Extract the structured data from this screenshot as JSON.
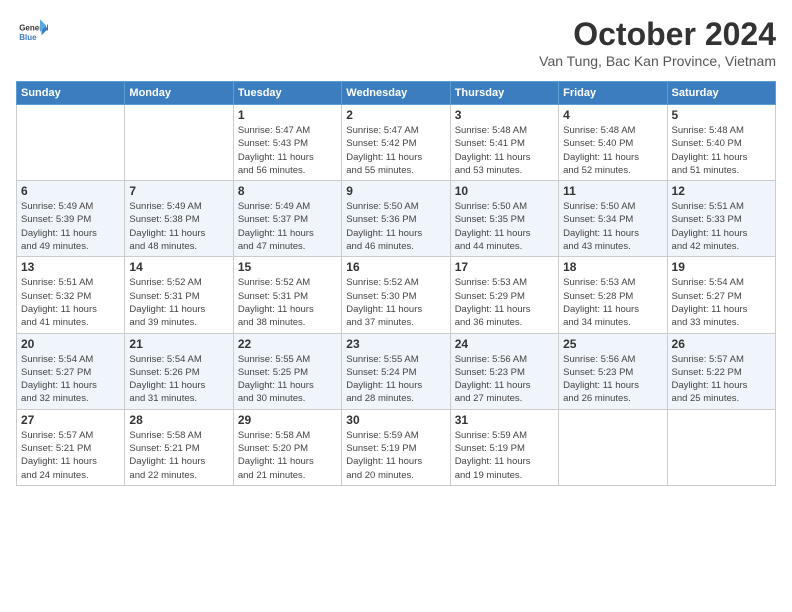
{
  "header": {
    "logo_line1": "General",
    "logo_line2": "Blue",
    "title": "October 2024",
    "subtitle": "Van Tung, Bac Kan Province, Vietnam"
  },
  "weekdays": [
    "Sunday",
    "Monday",
    "Tuesday",
    "Wednesday",
    "Thursday",
    "Friday",
    "Saturday"
  ],
  "weeks": [
    [
      {
        "day": "",
        "info": ""
      },
      {
        "day": "",
        "info": ""
      },
      {
        "day": "1",
        "info": "Sunrise: 5:47 AM\nSunset: 5:43 PM\nDaylight: 11 hours\nand 56 minutes."
      },
      {
        "day": "2",
        "info": "Sunrise: 5:47 AM\nSunset: 5:42 PM\nDaylight: 11 hours\nand 55 minutes."
      },
      {
        "day": "3",
        "info": "Sunrise: 5:48 AM\nSunset: 5:41 PM\nDaylight: 11 hours\nand 53 minutes."
      },
      {
        "day": "4",
        "info": "Sunrise: 5:48 AM\nSunset: 5:40 PM\nDaylight: 11 hours\nand 52 minutes."
      },
      {
        "day": "5",
        "info": "Sunrise: 5:48 AM\nSunset: 5:40 PM\nDaylight: 11 hours\nand 51 minutes."
      }
    ],
    [
      {
        "day": "6",
        "info": "Sunrise: 5:49 AM\nSunset: 5:39 PM\nDaylight: 11 hours\nand 49 minutes."
      },
      {
        "day": "7",
        "info": "Sunrise: 5:49 AM\nSunset: 5:38 PM\nDaylight: 11 hours\nand 48 minutes."
      },
      {
        "day": "8",
        "info": "Sunrise: 5:49 AM\nSunset: 5:37 PM\nDaylight: 11 hours\nand 47 minutes."
      },
      {
        "day": "9",
        "info": "Sunrise: 5:50 AM\nSunset: 5:36 PM\nDaylight: 11 hours\nand 46 minutes."
      },
      {
        "day": "10",
        "info": "Sunrise: 5:50 AM\nSunset: 5:35 PM\nDaylight: 11 hours\nand 44 minutes."
      },
      {
        "day": "11",
        "info": "Sunrise: 5:50 AM\nSunset: 5:34 PM\nDaylight: 11 hours\nand 43 minutes."
      },
      {
        "day": "12",
        "info": "Sunrise: 5:51 AM\nSunset: 5:33 PM\nDaylight: 11 hours\nand 42 minutes."
      }
    ],
    [
      {
        "day": "13",
        "info": "Sunrise: 5:51 AM\nSunset: 5:32 PM\nDaylight: 11 hours\nand 41 minutes."
      },
      {
        "day": "14",
        "info": "Sunrise: 5:52 AM\nSunset: 5:31 PM\nDaylight: 11 hours\nand 39 minutes."
      },
      {
        "day": "15",
        "info": "Sunrise: 5:52 AM\nSunset: 5:31 PM\nDaylight: 11 hours\nand 38 minutes."
      },
      {
        "day": "16",
        "info": "Sunrise: 5:52 AM\nSunset: 5:30 PM\nDaylight: 11 hours\nand 37 minutes."
      },
      {
        "day": "17",
        "info": "Sunrise: 5:53 AM\nSunset: 5:29 PM\nDaylight: 11 hours\nand 36 minutes."
      },
      {
        "day": "18",
        "info": "Sunrise: 5:53 AM\nSunset: 5:28 PM\nDaylight: 11 hours\nand 34 minutes."
      },
      {
        "day": "19",
        "info": "Sunrise: 5:54 AM\nSunset: 5:27 PM\nDaylight: 11 hours\nand 33 minutes."
      }
    ],
    [
      {
        "day": "20",
        "info": "Sunrise: 5:54 AM\nSunset: 5:27 PM\nDaylight: 11 hours\nand 32 minutes."
      },
      {
        "day": "21",
        "info": "Sunrise: 5:54 AM\nSunset: 5:26 PM\nDaylight: 11 hours\nand 31 minutes."
      },
      {
        "day": "22",
        "info": "Sunrise: 5:55 AM\nSunset: 5:25 PM\nDaylight: 11 hours\nand 30 minutes."
      },
      {
        "day": "23",
        "info": "Sunrise: 5:55 AM\nSunset: 5:24 PM\nDaylight: 11 hours\nand 28 minutes."
      },
      {
        "day": "24",
        "info": "Sunrise: 5:56 AM\nSunset: 5:23 PM\nDaylight: 11 hours\nand 27 minutes."
      },
      {
        "day": "25",
        "info": "Sunrise: 5:56 AM\nSunset: 5:23 PM\nDaylight: 11 hours\nand 26 minutes."
      },
      {
        "day": "26",
        "info": "Sunrise: 5:57 AM\nSunset: 5:22 PM\nDaylight: 11 hours\nand 25 minutes."
      }
    ],
    [
      {
        "day": "27",
        "info": "Sunrise: 5:57 AM\nSunset: 5:21 PM\nDaylight: 11 hours\nand 24 minutes."
      },
      {
        "day": "28",
        "info": "Sunrise: 5:58 AM\nSunset: 5:21 PM\nDaylight: 11 hours\nand 22 minutes."
      },
      {
        "day": "29",
        "info": "Sunrise: 5:58 AM\nSunset: 5:20 PM\nDaylight: 11 hours\nand 21 minutes."
      },
      {
        "day": "30",
        "info": "Sunrise: 5:59 AM\nSunset: 5:19 PM\nDaylight: 11 hours\nand 20 minutes."
      },
      {
        "day": "31",
        "info": "Sunrise: 5:59 AM\nSunset: 5:19 PM\nDaylight: 11 hours\nand 19 minutes."
      },
      {
        "day": "",
        "info": ""
      },
      {
        "day": "",
        "info": ""
      }
    ]
  ]
}
